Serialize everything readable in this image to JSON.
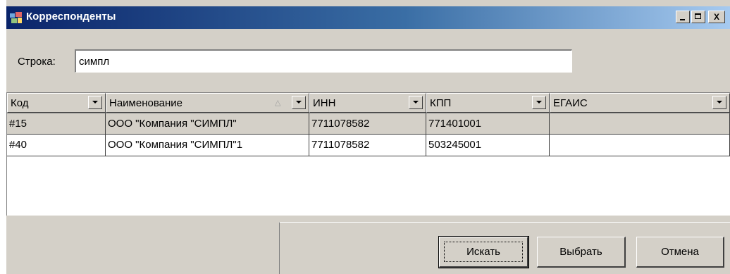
{
  "window": {
    "title": "Корреспонденты",
    "icon": "correspondents-app-icon",
    "controls": {
      "minimize": "minimize-icon",
      "maximize": "maximize-icon",
      "close": "X"
    }
  },
  "search": {
    "label": "Строка:",
    "value": "симпл"
  },
  "grid": {
    "columns": [
      {
        "label": "Код"
      },
      {
        "label": "Наименование",
        "sort_indicator": "△"
      },
      {
        "label": "ИНН"
      },
      {
        "label": "КПП"
      },
      {
        "label": "ЕГАИС"
      }
    ],
    "rows": [
      {
        "code": "#15",
        "name": "ООО \"Компания \"СИМПЛ\"",
        "inn": "7711078582",
        "kpp": "771401001",
        "egais": ""
      },
      {
        "code": "#40",
        "name": "ООО \"Компания \"СИМПЛ\"1",
        "inn": "7711078582",
        "kpp": "503245001",
        "egais": ""
      }
    ]
  },
  "buttons": {
    "search": "Искать",
    "select": "Выбрать",
    "cancel": "Отмена"
  },
  "colors": {
    "title_gradient_start": "#0a246a",
    "title_gradient_end": "#a6caf0",
    "face": "#d4d0c8"
  }
}
